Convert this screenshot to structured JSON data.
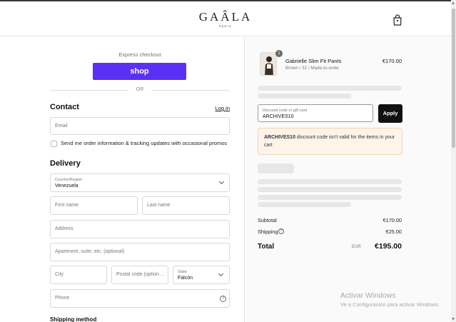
{
  "header": {
    "logo_text": "GAÂLA",
    "logo_sub": "PARIS",
    "cart_icon": "shopping-bag-icon"
  },
  "express": {
    "title": "Express checkout",
    "shop_label": "shop",
    "shop_color": "#5a31f4",
    "or_text": "OR"
  },
  "contact": {
    "heading": "Contact",
    "login_label": "Log in",
    "email_placeholder": "Email",
    "email_value": "",
    "news_label": "Send me order information & tracking updates with occasional promos",
    "news_checked": false
  },
  "delivery": {
    "heading": "Delivery",
    "country_label": "Country/Region",
    "country_value": "Venezuela",
    "first_name_placeholder": "First name",
    "last_name_placeholder": "Last name",
    "address_placeholder": "Address",
    "apartment_placeholder": "Apartment, suite, etc. (optional)",
    "city_placeholder": "City",
    "postal_placeholder": "Postal code (option…",
    "state_label": "State",
    "state_value": "Falcón",
    "phone_placeholder": "Phone",
    "shipping_method_heading": "Shipping method"
  },
  "summary": {
    "product": {
      "name": "Gabrielle Slim Fit Pants",
      "variant": "Brown / 32 / Made-to-order",
      "price": "€170.00",
      "quantity": "1"
    },
    "discount_label": "Discount code or gift card",
    "discount_value": "ARCHIVES10",
    "apply_label": "Apply",
    "error_code": "ARCHIVES10",
    "error_message": " discount code isn't valid for the items in your cart",
    "subtotal_label": "Subtotal",
    "subtotal_value": "€170.00",
    "shipping_label": "Shipping",
    "shipping_value": "€25.00",
    "total_label": "Total",
    "total_currency": "EUR",
    "total_value": "€195.00"
  },
  "watermark": {
    "line1": "Activar Windows",
    "line2": "Ve a Configuración para activar Windows."
  }
}
